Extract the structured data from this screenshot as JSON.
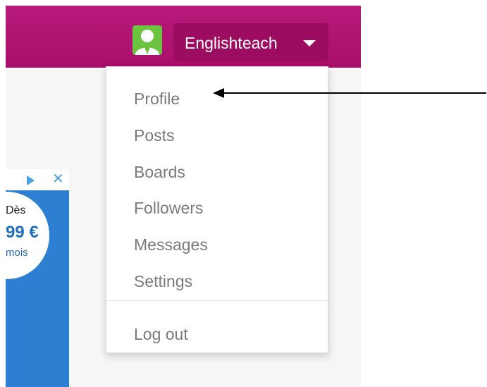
{
  "header": {
    "username": "Englishteach"
  },
  "menu": {
    "items": [
      {
        "label": "Profile"
      },
      {
        "label": "Posts"
      },
      {
        "label": "Boards"
      },
      {
        "label": "Followers"
      },
      {
        "label": "Messages"
      },
      {
        "label": "Settings"
      }
    ],
    "logout": "Log out"
  },
  "ad": {
    "line1": "Dès",
    "line2": "99 €",
    "line3": "mois"
  },
  "colors": {
    "header_bg": "#b01573",
    "user_button_bg": "#9c0d62",
    "avatar_bg": "#6cc33f",
    "menu_text": "#7a7a7a",
    "ad_blue": "#2d7fd1"
  },
  "icons": {
    "avatar": "user-microphone-avatar-icon",
    "caret": "caret-down-icon",
    "ad_choices": "play-triangle-icon",
    "ad_close": "close-icon",
    "annotation": "arrow-left-icon"
  }
}
